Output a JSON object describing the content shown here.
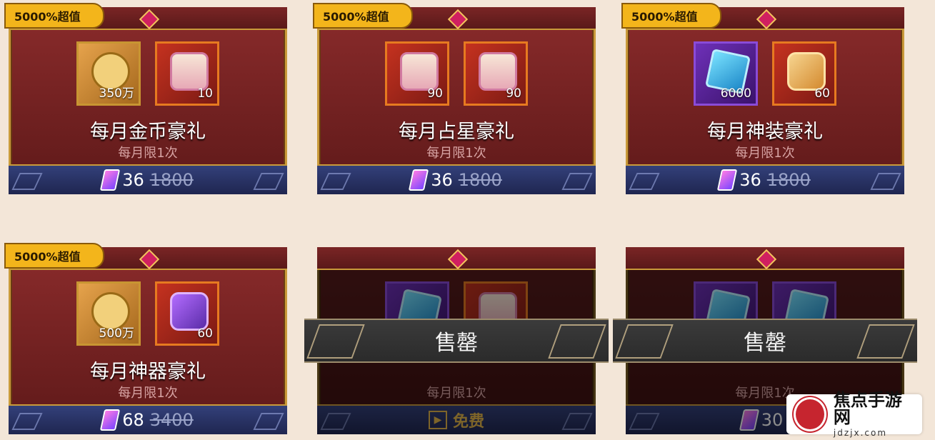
{
  "cards": [
    {
      "badge": "5000%超值",
      "items": [
        {
          "icon": "gold-coin-icon",
          "qty": "350万",
          "style": "gold"
        },
        {
          "icon": "astrology-scroll-icon",
          "qty": "10",
          "style": "red"
        }
      ],
      "title": "每月金币豪礼",
      "limit": "每月限1次",
      "price": "36",
      "old_price": "1800"
    },
    {
      "badge": "5000%超值",
      "items": [
        {
          "icon": "astrology-scroll-icon",
          "qty": "90",
          "style": "red"
        },
        {
          "icon": "astrology-scroll-icon",
          "qty": "90",
          "style": "red"
        }
      ],
      "title": "每月占星豪礼",
      "limit": "每月限1次",
      "price": "36",
      "old_price": "1800"
    },
    {
      "badge": "5000%超值",
      "items": [
        {
          "icon": "blue-crystal-icon",
          "qty": "6000",
          "style": "purple"
        },
        {
          "icon": "golden-key-icon",
          "qty": "60",
          "style": "red"
        }
      ],
      "title": "每月神装豪礼",
      "limit": "每月限1次",
      "price": "36",
      "old_price": "1800"
    },
    {
      "badge": "5000%超值",
      "items": [
        {
          "icon": "gold-coin-icon",
          "qty": "500万",
          "style": "gold"
        },
        {
          "icon": "purple-key-icon",
          "qty": "60",
          "style": "red"
        }
      ],
      "title": "每月神器豪礼",
      "limit": "每月限1次",
      "price": "68",
      "old_price": "3400"
    },
    {
      "sold_out": "售罄",
      "items": [
        {
          "icon": "blue-crystal-icon",
          "qty": "",
          "style": "purple"
        },
        {
          "icon": "astrology-scroll-icon",
          "qty": "",
          "style": "red"
        }
      ],
      "title": "",
      "limit": "每月限1次",
      "free_label": "免费"
    },
    {
      "sold_out": "售罄",
      "items": [
        {
          "icon": "blue-crystal-icon",
          "qty": "",
          "style": "purple"
        },
        {
          "icon": "blue-crystal-icon",
          "qty": "",
          "style": "purple"
        }
      ],
      "title": "",
      "limit": "每月限1次",
      "price": "30",
      "old_price": ""
    }
  ],
  "watermark": {
    "cn": "焦点手游网",
    "en": "jdzjx.com"
  }
}
